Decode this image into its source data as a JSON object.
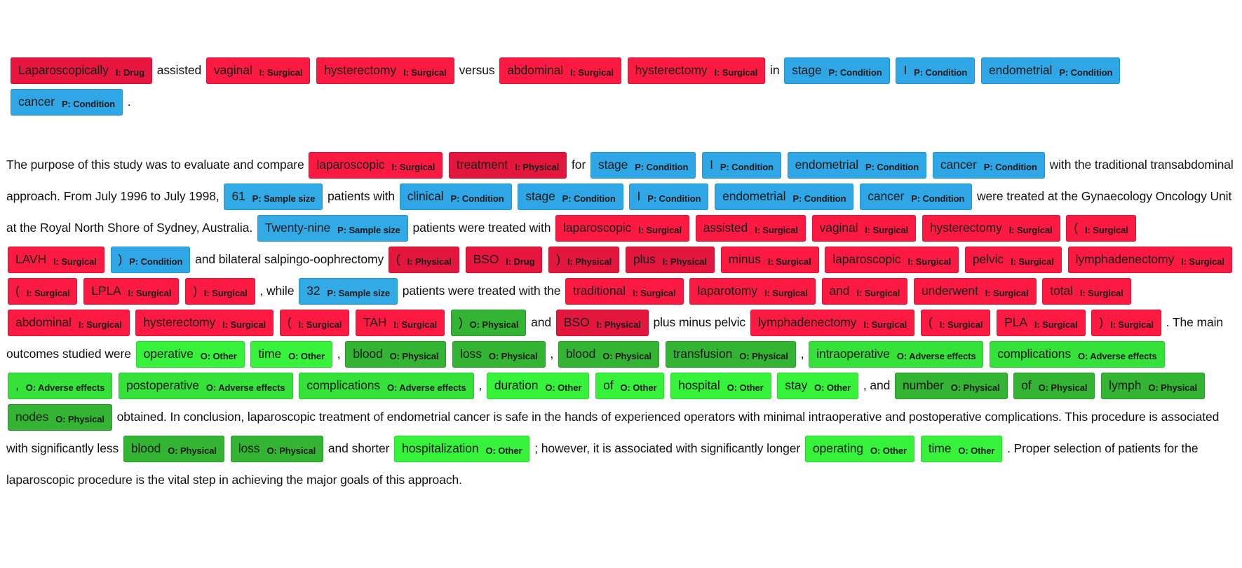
{
  "title_tokens": [
    {
      "t": "Laparoscopically",
      "l": "I: Drug",
      "c": "drug"
    },
    {
      "t": "assisted"
    },
    {
      "t": "vaginal",
      "l": "I: Surgical",
      "c": "surgical"
    },
    {
      "t": "hysterectomy",
      "l": "I: Surgical",
      "c": "surgical"
    },
    {
      "t": "versus"
    },
    {
      "t": "abdominal",
      "l": "I: Surgical",
      "c": "surgical"
    },
    {
      "t": "hysterectomy",
      "l": "I: Surgical",
      "c": "surgical"
    },
    {
      "t": "in"
    },
    {
      "t": "stage",
      "l": "P: Condition",
      "c": "condition"
    },
    {
      "t": "I",
      "l": "P: Condition",
      "c": "condition"
    },
    {
      "t": "endometrial",
      "l": "P: Condition",
      "c": "condition"
    },
    {
      "t": "cancer",
      "l": "P: Condition",
      "c": "condition"
    },
    {
      "t": "."
    }
  ],
  "abstract_tokens": [
    {
      "t": "The purpose of this study was to evaluate and compare"
    },
    {
      "t": "laparoscopic",
      "l": "I: Surgical",
      "c": "surgical"
    },
    {
      "t": "treatment",
      "l": "I: Physical",
      "c": "physical"
    },
    {
      "t": "for"
    },
    {
      "t": "stage",
      "l": "P: Condition",
      "c": "condition"
    },
    {
      "t": "I",
      "l": "P: Condition",
      "c": "condition"
    },
    {
      "t": "endometrial",
      "l": "P: Condition",
      "c": "condition"
    },
    {
      "t": "cancer",
      "l": "P: Condition",
      "c": "condition"
    },
    {
      "t": "with the traditional transabdominal approach. From July 1996 to July 1998,"
    },
    {
      "t": "61",
      "l": "P: Sample size",
      "c": "sample"
    },
    {
      "t": "patients with"
    },
    {
      "t": "clinical",
      "l": "P: Condition",
      "c": "condition"
    },
    {
      "t": "stage",
      "l": "P: Condition",
      "c": "condition"
    },
    {
      "t": "I",
      "l": "P: Condition",
      "c": "condition"
    },
    {
      "t": "endometrial",
      "l": "P: Condition",
      "c": "condition"
    },
    {
      "t": "cancer",
      "l": "P: Condition",
      "c": "condition"
    },
    {
      "t": "were treated at the Gynaecology Oncology Unit at the Royal North Shore of Sydney, Australia."
    },
    {
      "t": "Twenty-nine",
      "l": "P: Sample size",
      "c": "sample"
    },
    {
      "t": "patients were treated with"
    },
    {
      "t": "laparoscopic",
      "l": "I: Surgical",
      "c": "surgical"
    },
    {
      "t": "assisted",
      "l": "I: Surgical",
      "c": "surgical"
    },
    {
      "t": "vaginal",
      "l": "I: Surgical",
      "c": "surgical"
    },
    {
      "t": "hysterectomy",
      "l": "I: Surgical",
      "c": "surgical"
    },
    {
      "t": "(",
      "l": "I: Surgical",
      "c": "surgical"
    },
    {
      "t": "LAVH",
      "l": "I: Surgical",
      "c": "surgical"
    },
    {
      "t": ")",
      "l": "P: Condition",
      "c": "condition"
    },
    {
      "t": "and bilateral salpingo-oophrectomy"
    },
    {
      "t": "(",
      "l": "I: Physical",
      "c": "physical"
    },
    {
      "t": "BSO",
      "l": "I: Drug",
      "c": "drug"
    },
    {
      "t": ")",
      "l": "I: Physical",
      "c": "physical"
    },
    {
      "t": "plus",
      "l": "I: Physical",
      "c": "physical"
    },
    {
      "t": "minus",
      "l": "I: Surgical",
      "c": "surgical"
    },
    {
      "t": "laparoscopic",
      "l": "I: Surgical",
      "c": "surgical"
    },
    {
      "t": "pelvic",
      "l": "I: Surgical",
      "c": "surgical"
    },
    {
      "t": "lymphadenectomy",
      "l": "I: Surgical",
      "c": "surgical"
    },
    {
      "t": "(",
      "l": "I: Surgical",
      "c": "surgical"
    },
    {
      "t": "LPLA",
      "l": "I: Surgical",
      "c": "surgical"
    },
    {
      "t": ")",
      "l": "I: Surgical",
      "c": "surgical"
    },
    {
      "t": ", while"
    },
    {
      "t": "32",
      "l": "P: Sample size",
      "c": "sample"
    },
    {
      "t": "patients were treated with the"
    },
    {
      "t": "traditional",
      "l": "I: Surgical",
      "c": "surgical"
    },
    {
      "t": "laparotomy",
      "l": "I: Surgical",
      "c": "surgical"
    },
    {
      "t": "and",
      "l": "I: Surgical",
      "c": "surgical"
    },
    {
      "t": "underwent",
      "l": "I: Surgical",
      "c": "surgical"
    },
    {
      "t": "total",
      "l": "I: Surgical",
      "c": "surgical"
    },
    {
      "t": "abdominal",
      "l": "I: Surgical",
      "c": "surgical"
    },
    {
      "t": "hysterectomy",
      "l": "I: Surgical",
      "c": "surgical"
    },
    {
      "t": "(",
      "l": "I: Surgical",
      "c": "surgical"
    },
    {
      "t": "TAH",
      "l": "I: Surgical",
      "c": "surgical"
    },
    {
      "t": ")",
      "l": "O: Physical",
      "c": "ophysical"
    },
    {
      "t": "and"
    },
    {
      "t": "BSO",
      "l": "I: Physical",
      "c": "physical"
    },
    {
      "t": "plus minus pelvic"
    },
    {
      "t": "lymphadenectomy",
      "l": "I: Surgical",
      "c": "surgical"
    },
    {
      "t": "(",
      "l": "I: Surgical",
      "c": "surgical"
    },
    {
      "t": "PLA",
      "l": "I: Surgical",
      "c": "surgical"
    },
    {
      "t": ")",
      "l": "I: Surgical",
      "c": "surgical"
    },
    {
      "t": ". The main outcomes studied were"
    },
    {
      "t": "operative",
      "l": "O: Other",
      "c": "oother"
    },
    {
      "t": "time",
      "l": "O: Other",
      "c": "oother"
    },
    {
      "t": ","
    },
    {
      "t": "blood",
      "l": "O: Physical",
      "c": "ophysical"
    },
    {
      "t": "loss",
      "l": "O: Physical",
      "c": "ophysical"
    },
    {
      "t": ","
    },
    {
      "t": "blood",
      "l": "O: Physical",
      "c": "ophysical"
    },
    {
      "t": "transfusion",
      "l": "O: Physical",
      "c": "ophysical"
    },
    {
      "t": ","
    },
    {
      "t": "intraoperative",
      "l": "O: Adverse effects",
      "c": "oadverse"
    },
    {
      "t": "complications",
      "l": "O: Adverse effects",
      "c": "oadverse"
    },
    {
      "t": ",",
      "l": "O: Adverse effects",
      "c": "oadverse"
    },
    {
      "t": "postoperative",
      "l": "O: Adverse effects",
      "c": "oadverse"
    },
    {
      "t": "complications",
      "l": "O: Adverse effects",
      "c": "oadverse"
    },
    {
      "t": ","
    },
    {
      "t": "duration",
      "l": "O: Other",
      "c": "oother"
    },
    {
      "t": "of",
      "l": "O: Other",
      "c": "oother"
    },
    {
      "t": "hospital",
      "l": "O: Other",
      "c": "oother"
    },
    {
      "t": "stay",
      "l": "O: Other",
      "c": "oother"
    },
    {
      "t": ", and"
    },
    {
      "t": "number",
      "l": "O: Physical",
      "c": "ophysical"
    },
    {
      "t": "of",
      "l": "O: Physical",
      "c": "ophysical"
    },
    {
      "t": "lymph",
      "l": "O: Physical",
      "c": "ophysical"
    },
    {
      "t": "nodes",
      "l": "O: Physical",
      "c": "ophysical"
    },
    {
      "t": "obtained. In conclusion, laparoscopic treatment of endometrial cancer is safe in the hands of experienced operators with minimal intraoperative and postoperative complications. This procedure is associated with significantly less"
    },
    {
      "t": "blood",
      "l": "O: Physical",
      "c": "ophysical"
    },
    {
      "t": "loss",
      "l": "O: Physical",
      "c": "ophysical"
    },
    {
      "t": "and shorter"
    },
    {
      "t": "hospitalization",
      "l": "O: Other",
      "c": "oother"
    },
    {
      "t": "; however, it is associated with significantly longer"
    },
    {
      "t": "operating",
      "l": "O: Other",
      "c": "oother"
    },
    {
      "t": "time",
      "l": "O: Other",
      "c": "oother"
    },
    {
      "t": ". Proper selection of patients for the laparoscopic procedure is the vital step in achieving the major goals of this approach."
    }
  ]
}
